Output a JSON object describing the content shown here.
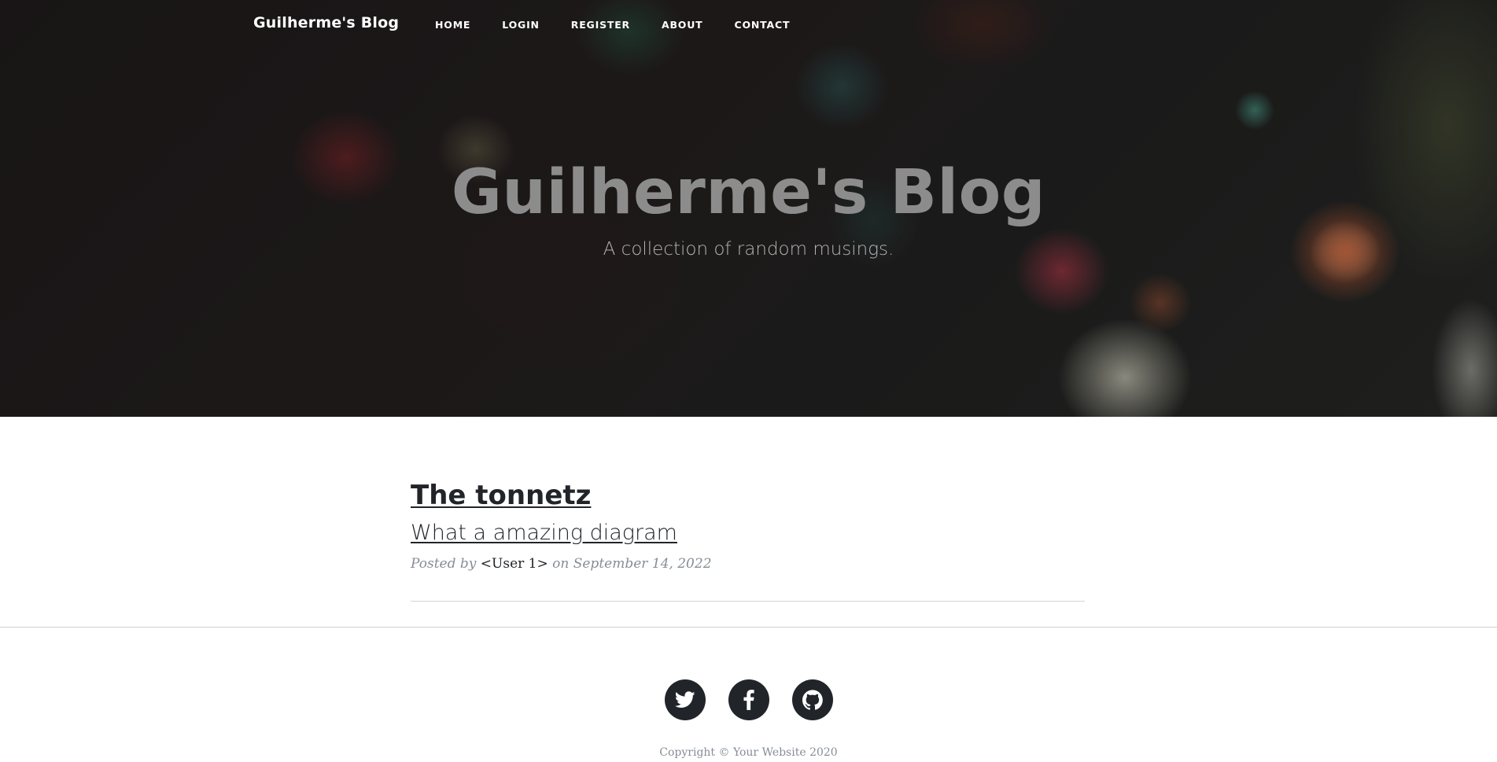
{
  "nav": {
    "brand": "Guilherme's Blog",
    "links": [
      "HOME",
      "LOGIN",
      "REGISTER",
      "ABOUT",
      "CONTACT"
    ]
  },
  "hero": {
    "title": "Guilherme's Blog",
    "subtitle": "A collection of random musings."
  },
  "posts": [
    {
      "title": "The tonnetz",
      "subtitle": "What a amazing diagram",
      "meta_prefix": "Posted by",
      "author": "<User 1>",
      "meta_suffix": "on September 14, 2022"
    }
  ],
  "footer": {
    "social_icons": [
      "twitter-icon",
      "facebook-icon",
      "github-icon"
    ],
    "copyright": "Copyright © Your Website 2020"
  },
  "colors": {
    "text_dark": "#212529",
    "muted": "#868e96",
    "hero_title": "#8c8c8c"
  }
}
